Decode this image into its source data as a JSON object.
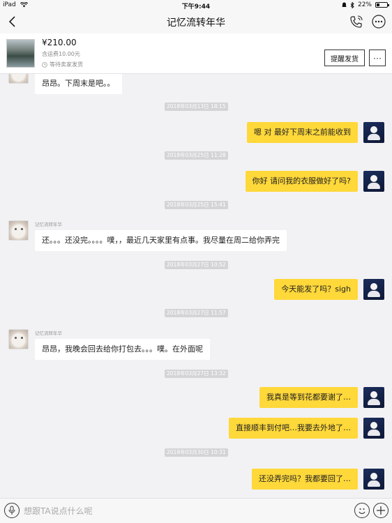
{
  "status_bar": {
    "device": "iPad",
    "time": "下午9:44",
    "battery": "22%",
    "battery_level": 0.22
  },
  "nav": {
    "title": "记忆流转年华"
  },
  "product": {
    "price": "¥210.00",
    "shipping": "含运费10.00元",
    "status": "等待卖家发货",
    "remind_button": "提醒发货",
    "more_button": "···"
  },
  "chat": {
    "sender_name": "记忆流转年华",
    "items": [
      {
        "kind": "msg",
        "dir": "in",
        "text": "昂昂。下周末是吧。。"
      },
      {
        "kind": "stamp",
        "text": "2018年03月13日 18:15"
      },
      {
        "kind": "msg",
        "dir": "out",
        "text": "嗯 对 最好下周末之前能收到"
      },
      {
        "kind": "stamp",
        "text": "2018年03月25日 11:28"
      },
      {
        "kind": "msg",
        "dir": "out",
        "text": "你好 请问我的衣服做好了吗?"
      },
      {
        "kind": "stamp",
        "text": "2018年03月25日 15:41"
      },
      {
        "kind": "msg",
        "dir": "in",
        "text": "还。。。还没完。。。。噗，，最近几天家里有点事。我尽量在周二给你弄完"
      },
      {
        "kind": "stamp",
        "text": "2018年03月27日 10:52"
      },
      {
        "kind": "msg",
        "dir": "out",
        "text": "今天能发了吗？sigh"
      },
      {
        "kind": "stamp",
        "text": "2018年03月27日 11:57"
      },
      {
        "kind": "msg",
        "dir": "in",
        "text": "昂昂，我晚会回去给你打包去。。。噗。在外面呢"
      },
      {
        "kind": "stamp",
        "text": "2018年03月27日 13:32"
      },
      {
        "kind": "msg",
        "dir": "out",
        "text": "我真是等到花都要谢了…"
      },
      {
        "kind": "msg",
        "dir": "out",
        "text": "直接顺丰到付吧…我要去外地了…"
      },
      {
        "kind": "stamp",
        "text": "2018年03月30日 10:31"
      },
      {
        "kind": "msg",
        "dir": "out",
        "text": "还没弄完吗？我都要回了…"
      }
    ]
  },
  "input": {
    "placeholder": "想跟TA说点什么呢"
  }
}
